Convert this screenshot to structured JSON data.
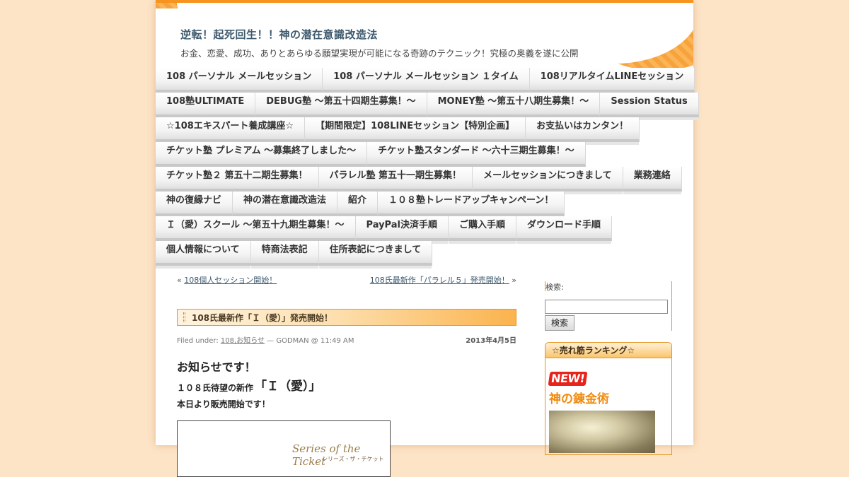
{
  "site": {
    "title": "逆転！起死回生！！神の潜在意識改造法",
    "description": "お金、恋愛、成功、ありとあらゆる願望実現が可能になる奇跡のテクニック！究極の奥義を遂に公開"
  },
  "nav": {
    "rows": [
      [
        "108 パーソナル メールセッション",
        "108 パーソナル メールセッション １タイム",
        "108リアルタイムLINEセッション"
      ],
      [
        "108塾ULTIMATE",
        "DEBUG塾 ～第五十四期生募集！～",
        "MONEY塾 ～第五十八期生募集！～",
        "Session Status"
      ],
      [
        "☆108エキスパート養成講座☆",
        "【期間限定】108LINEセッション【特別企画】",
        "お支払いはカンタン！"
      ],
      [
        "チケット塾 プレミアム ～募集終了しました～",
        "チケット塾スタンダード ～六十三期生募集！～"
      ],
      [
        "チケット塾２ 第五十二期生募集！",
        "パラレル塾 第五十一期生募集！",
        "メールセッションにつきまして",
        "業務連絡"
      ],
      [
        "神の復縁ナビ",
        "神の潜在意識改造法",
        "紹介",
        "１０８塾トレードアップキャンペーン！"
      ],
      [
        "Ｉ（愛）スクール ～第五十九期生募集！～",
        "PayPal決済手順",
        "ご購入手順",
        "ダウンロード手順"
      ],
      [
        "個人情報について",
        "特商法表記",
        "住所表記につきまして"
      ]
    ]
  },
  "post": {
    "prev_arrow": "«",
    "prev_link": "108個人セッション開始！",
    "next_link": "108氏最新作「パラレル５」発売開始！",
    "next_arrow": "»",
    "title": "108氏最新作「Ｉ（愛）」発売開始！",
    "filed_under": "Filed under: ",
    "categories": "108,お知らせ",
    "author_time": " — GODMAN @ 11:49 AM",
    "date": "2013年4月5日",
    "line1": "お知らせです！",
    "line2_prefix": "１０８氏待望の新作",
    "line2_title": "「Ｉ（愛）」",
    "line3": "本日より販売開始です！",
    "image_script": "Series of the Ticket",
    "image_sub": "シリーズ・ザ・チケット"
  },
  "sidebar": {
    "search_label": "検索:",
    "search_value": "",
    "search_button": "検索",
    "ranking_title": "☆売れ筋ランキング☆",
    "new_badge": "NEW!",
    "product_name": "神の錬金術"
  }
}
